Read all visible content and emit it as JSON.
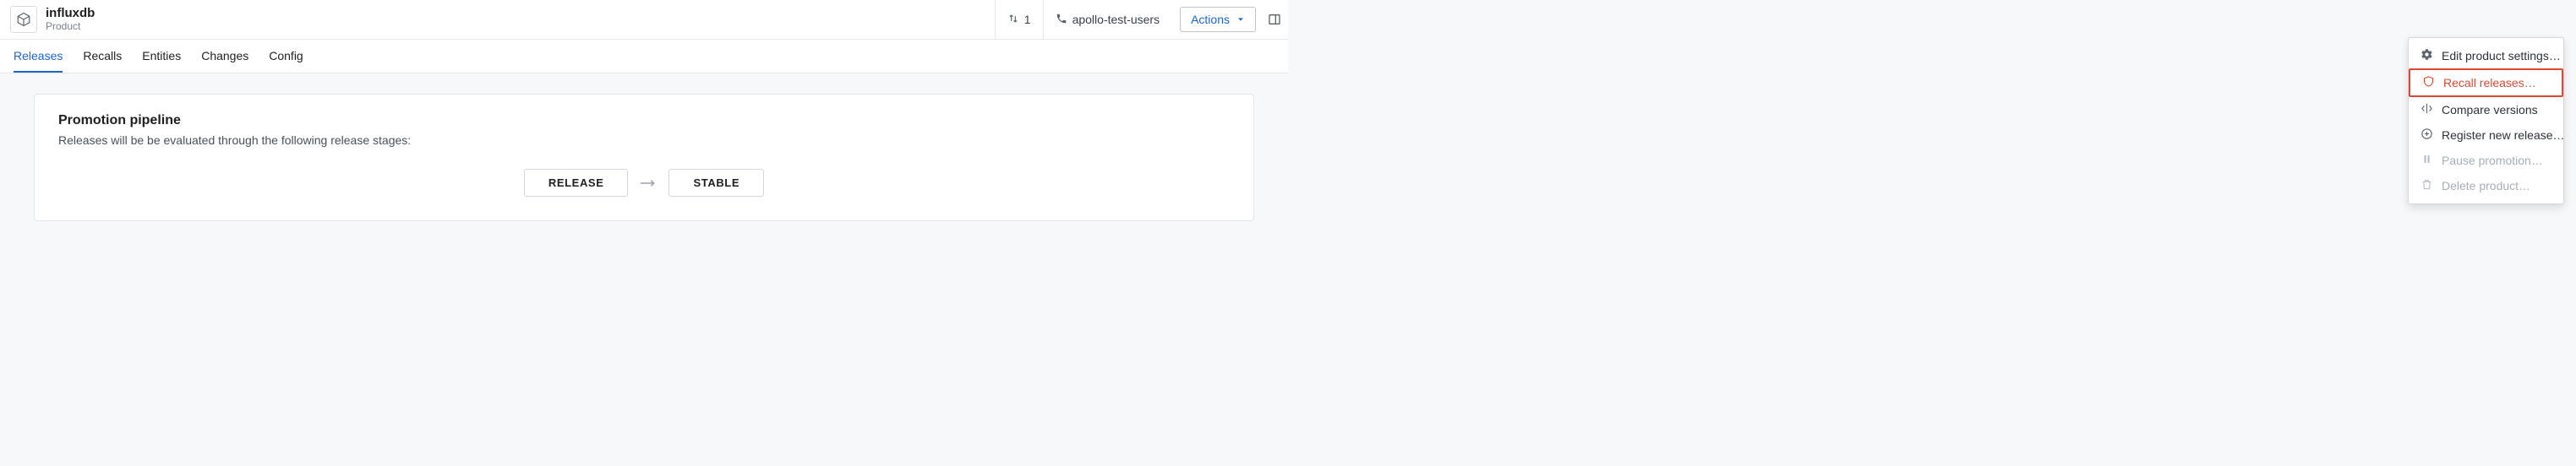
{
  "header": {
    "product_title": "influxdb",
    "product_subtitle": "Product",
    "sort_count": "1",
    "support_label": "apollo-test-users",
    "actions_label": "Actions"
  },
  "tabs": [
    {
      "label": "Releases",
      "active": true
    },
    {
      "label": "Recalls",
      "active": false
    },
    {
      "label": "Entities",
      "active": false
    },
    {
      "label": "Changes",
      "active": false
    },
    {
      "label": "Config",
      "active": false
    }
  ],
  "panel": {
    "title": "Promotion pipeline",
    "description": "Releases will be be evaluated through the following release stages:",
    "stages": [
      "RELEASE",
      "STABLE"
    ]
  },
  "actions_menu": {
    "items": [
      {
        "key": "edit",
        "label": "Edit product settings…",
        "disabled": false,
        "highlight": false
      },
      {
        "key": "recall",
        "label": "Recall releases…",
        "disabled": false,
        "highlight": true
      },
      {
        "key": "compare",
        "label": "Compare versions",
        "disabled": false,
        "highlight": false
      },
      {
        "key": "register",
        "label": "Register new release…",
        "disabled": false,
        "highlight": false
      },
      {
        "key": "pause",
        "label": "Pause promotion…",
        "disabled": true,
        "highlight": false
      },
      {
        "key": "delete",
        "label": "Delete product…",
        "disabled": true,
        "highlight": false
      }
    ]
  }
}
